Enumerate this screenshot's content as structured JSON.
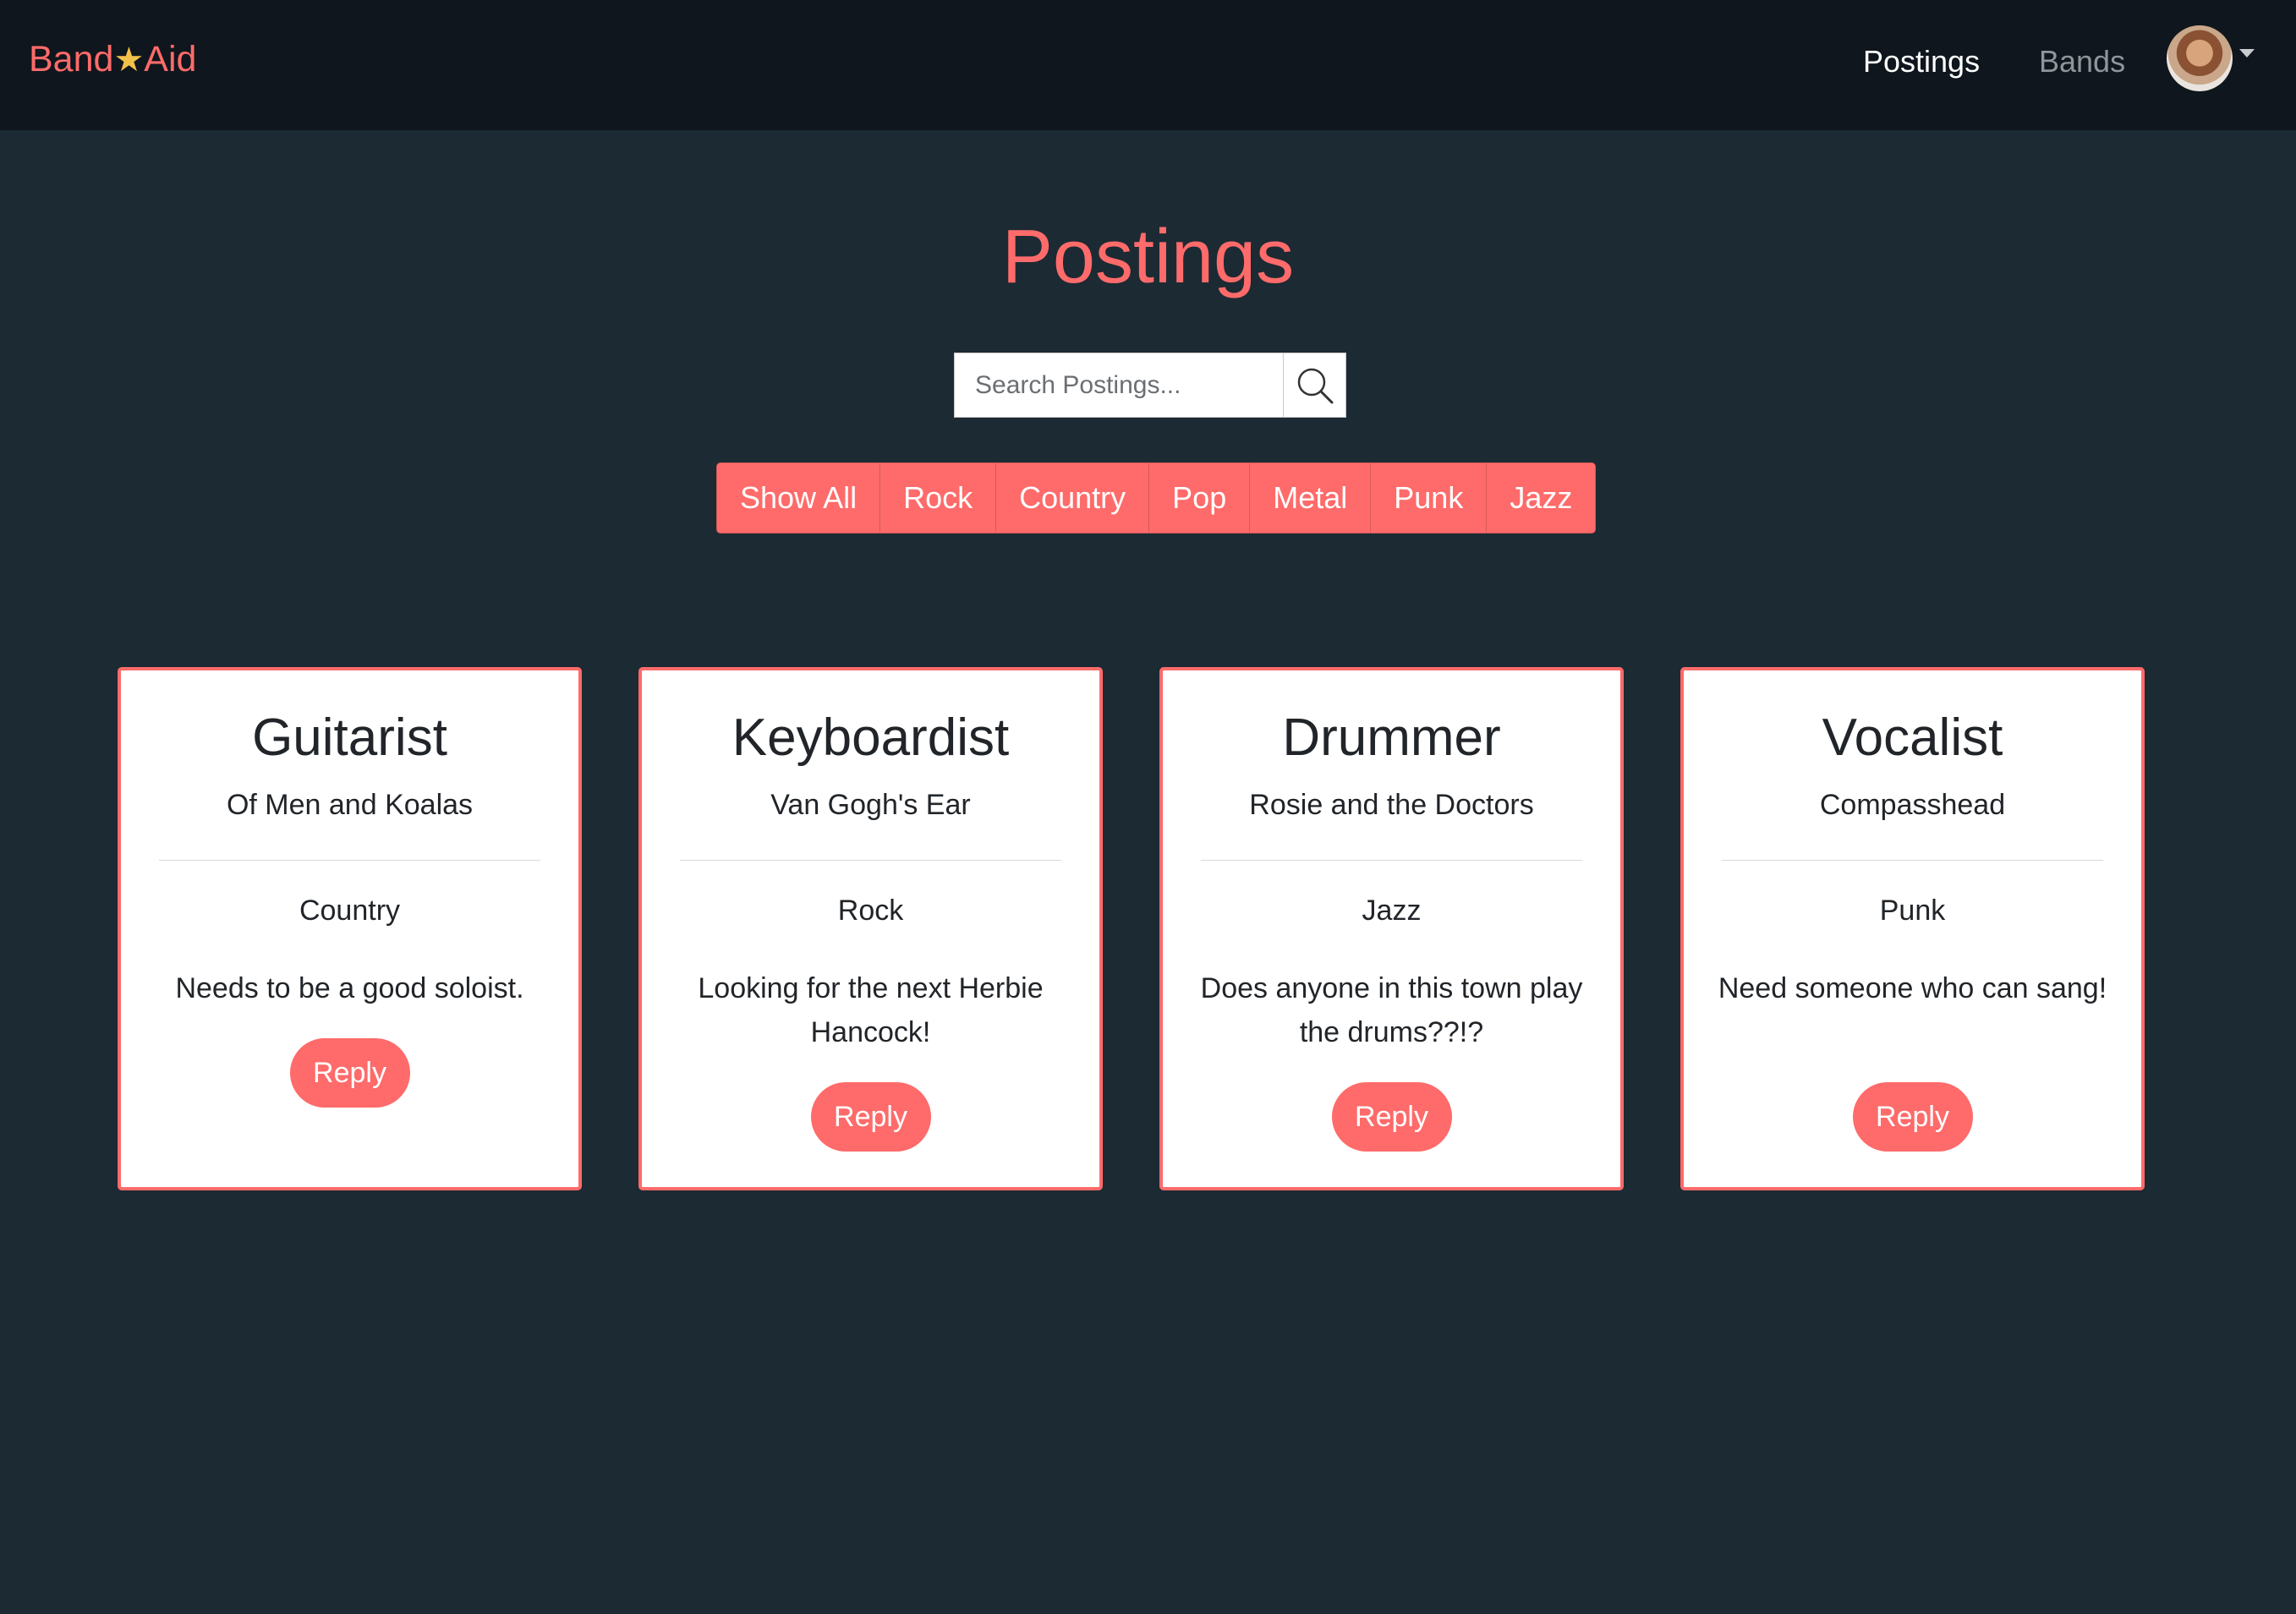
{
  "navbar": {
    "brand_left": "Band",
    "brand_star": "★",
    "brand_right": "Aid",
    "links": [
      "Postings",
      "Bands"
    ],
    "profile_icon": "user-avatar",
    "dropdown_icon": "caret-down-icon"
  },
  "page": {
    "title": "Postings"
  },
  "search": {
    "placeholder": "Search Postings...",
    "value": "",
    "icon": "search-icon"
  },
  "filters": [
    "Show All",
    "Rock",
    "Country",
    "Pop",
    "Metal",
    "Punk",
    "Jazz"
  ],
  "postings": [
    {
      "title": "Guitarist",
      "band": "Of Men and Koalas",
      "genre": "Country",
      "description": "Needs to be a good soloist.",
      "reply_label": "Reply"
    },
    {
      "title": "Keyboardist",
      "band": "Van Gogh's Ear",
      "genre": "Rock",
      "description": "Looking for the next Herbie Hancock!",
      "reply_label": "Reply"
    },
    {
      "title": "Drummer",
      "band": "Rosie and the Doctors",
      "genre": "Jazz",
      "description": "Does anyone in this town play the drums??!?",
      "reply_label": "Reply"
    },
    {
      "title": "Vocalist",
      "band": "Compasshead",
      "genre": "Punk",
      "description": "Need someone who can sang!",
      "reply_label": "Reply"
    }
  ],
  "colors": {
    "accent": "#fe6b6a",
    "background": "#1c2a33",
    "navbar": "#0f161d",
    "star": "#f3c14a",
    "card": "#ffffff"
  }
}
